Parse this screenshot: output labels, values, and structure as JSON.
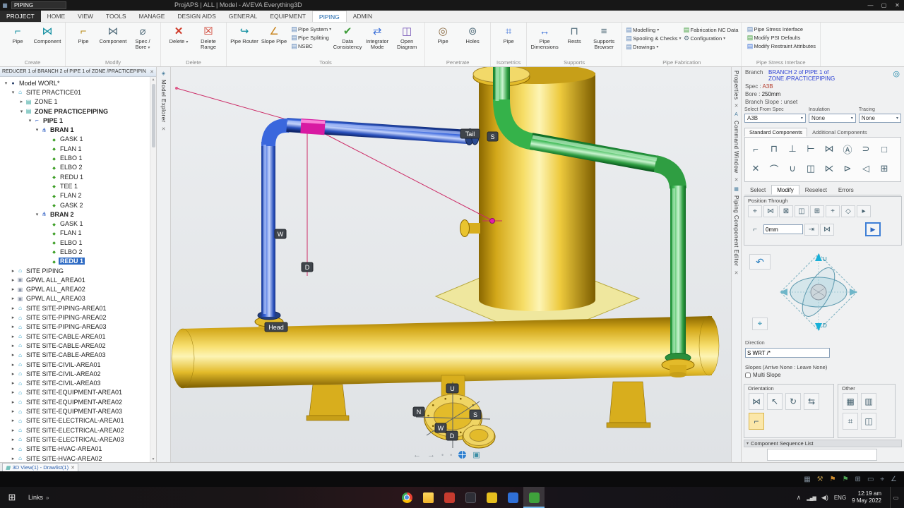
{
  "colors": {
    "selection": "#2e6bc4",
    "pipe_blue": "#2d5bd1",
    "pipe_green": "#35b24a",
    "equipment_yellow": "#e9c42f",
    "highlight_magenta": "#e31eaa",
    "construction_pink": "#cc2b66",
    "link_blue": "#2a3fd4",
    "spec_red": "#b23a2a"
  },
  "titlebar": {
    "quick_search": "PIPING",
    "title": "ProjAPS | ALL | Model - AVEVA Everything3D"
  },
  "tabs": [
    {
      "label": "PROJECT",
      "cls": "project"
    },
    {
      "label": "HOME"
    },
    {
      "label": "VIEW"
    },
    {
      "label": "TOOLS"
    },
    {
      "label": "MANAGE"
    },
    {
      "label": "DESIGN AIDS"
    },
    {
      "label": "GENERAL"
    },
    {
      "label": "EQUIPMENT"
    },
    {
      "label": "PIPING",
      "cls": "on"
    },
    {
      "label": "ADMIN"
    }
  ],
  "ribbon": {
    "groups": {
      "create": {
        "label": "Create",
        "pipe": "Pipe",
        "component": "Component"
      },
      "modify": {
        "label": "Modify",
        "pipe": "Pipe",
        "component": "Component",
        "spec_bore": "Spec / Bore"
      },
      "delete": {
        "label": "Delete",
        "del": "Delete",
        "range": "Delete Range"
      },
      "tools": {
        "label": "Tools",
        "router": "Pipe Router",
        "slope": "Slope Pipe",
        "checks": [
          {
            "label": "Pipe System",
            "icon": "rb-doc",
            "cls": "caret"
          },
          {
            "label": "Pipe Splitting",
            "icon": "rb-doc"
          },
          {
            "label": "NSBC",
            "icon": "rb-doc"
          }
        ],
        "data_consistency": "Data Consistency",
        "integrator": "Integrator Mode",
        "diagram": "Open Diagram"
      },
      "penetrate": {
        "label": "Penetrate",
        "pipe": "Pipe",
        "holes": "Holes"
      },
      "isometrics": {
        "label": "Isometrics",
        "pipe": "Pipe"
      },
      "supports": {
        "label": "Supports",
        "dimensions": "Pipe Dimensions",
        "rests": "Rests",
        "browser": "Supports Browser"
      },
      "fabrication": {
        "label": "Pipe Fabrication",
        "items": [
          {
            "label": "Modelling",
            "icon": "rb-doc",
            "cls": "caret"
          },
          {
            "label": "Spooling & Checks",
            "icon": "rb-doc",
            "cls": "caret"
          },
          {
            "label": "Drawings",
            "icon": "rb-doc",
            "cls": "caret"
          },
          {
            "label": "Fabrication NC Data",
            "icon": "rb-doc-g"
          },
          {
            "label": "Configuration",
            "icon": "rb-gear",
            "cls": "caret"
          }
        ]
      },
      "stress": {
        "label": "Pipe Stress Interface",
        "items": [
          {
            "label": "Pipe Stress Interface",
            "icon": "rb-doc"
          },
          {
            "label": "Modify PSI Defaults",
            "icon": "rb-doc-g"
          },
          {
            "label": "Modify Restraint Attributes",
            "icon": "rb-doc-b"
          }
        ]
      }
    }
  },
  "explorer": {
    "header": "REDUCER 1 of BRANCH 2 of PIPE 1 of ZONE /PRACTICEPIPIN",
    "strip_title": "Model Explorer",
    "items": [
      {
        "label": "Model WORL*",
        "cls": "d0 eo",
        "icon": "world"
      },
      {
        "label": "SITE PRACTICE01",
        "cls": "d1 eo",
        "icon": "site"
      },
      {
        "label": "ZONE 1",
        "cls": "d2 ec",
        "icon": "zone"
      },
      {
        "label": "ZONE PRACTICEPIPING",
        "cls": "d2 eo bold",
        "icon": "zone"
      },
      {
        "label": "PIPE 1",
        "cls": "d3 eo bold",
        "icon": "pipe"
      },
      {
        "label": "BRAN 1",
        "cls": "d4 eo bold",
        "icon": "bran"
      },
      {
        "label": "GASK 1",
        "cls": "d5 en",
        "icon": "comp"
      },
      {
        "label": "FLAN 1",
        "cls": "d5 en",
        "icon": "comp"
      },
      {
        "label": "ELBO 1",
        "cls": "d5 en",
        "icon": "comp"
      },
      {
        "label": "ELBO 2",
        "cls": "d5 en",
        "icon": "comp"
      },
      {
        "label": "REDU 1",
        "cls": "d5 en",
        "icon": "comp"
      },
      {
        "label": "TEE 1",
        "cls": "d5 en",
        "icon": "comp"
      },
      {
        "label": "FLAN 2",
        "cls": "d5 en",
        "icon": "comp"
      },
      {
        "label": "GASK 2",
        "cls": "d5 en",
        "icon": "comp"
      },
      {
        "label": "BRAN 2",
        "cls": "d4 eo bold",
        "icon": "bran"
      },
      {
        "label": "GASK 1",
        "cls": "d5 en",
        "icon": "comp"
      },
      {
        "label": "FLAN 1",
        "cls": "d5 en",
        "icon": "comp"
      },
      {
        "label": "ELBO 1",
        "cls": "d5 en",
        "icon": "comp"
      },
      {
        "label": "ELBO 2",
        "cls": "d5 en",
        "icon": "comp"
      },
      {
        "label": "REDU 1",
        "cls": "d5 en sel bold",
        "icon": "comp"
      },
      {
        "label": "SITE PIPING",
        "cls": "d1 ec",
        "icon": "site"
      },
      {
        "label": "GPWL ALL_AREA01",
        "cls": "d1 ec",
        "icon": "gpwl"
      },
      {
        "label": "GPWL ALL_AREA02",
        "cls": "d1 ec",
        "icon": "gpwl"
      },
      {
        "label": "GPWL ALL_AREA03",
        "cls": "d1 ec",
        "icon": "gpwl"
      },
      {
        "label": "SITE SITE-PIPING-AREA01",
        "cls": "d1 ec",
        "icon": "site"
      },
      {
        "label": "SITE SITE-PIPING-AREA02",
        "cls": "d1 ec",
        "icon": "site"
      },
      {
        "label": "SITE SITE-PIPING-AREA03",
        "cls": "d1 ec",
        "icon": "site"
      },
      {
        "label": "SITE SITE-CABLE-AREA01",
        "cls": "d1 ec",
        "icon": "site"
      },
      {
        "label": "SITE SITE-CABLE-AREA02",
        "cls": "d1 ec",
        "icon": "site"
      },
      {
        "label": "SITE SITE-CABLE-AREA03",
        "cls": "d1 ec",
        "icon": "site"
      },
      {
        "label": "SITE SITE-CIVIL-AREA01",
        "cls": "d1 ec",
        "icon": "site"
      },
      {
        "label": "SITE SITE-CIVIL-AREA02",
        "cls": "d1 ec",
        "icon": "site"
      },
      {
        "label": "SITE SITE-CIVIL-AREA03",
        "cls": "d1 ec",
        "icon": "site"
      },
      {
        "label": "SITE SITE-EQUIPMENT-AREA01",
        "cls": "d1 ec",
        "icon": "site"
      },
      {
        "label": "SITE SITE-EQUIPMENT-AREA02",
        "cls": "d1 ec",
        "icon": "site"
      },
      {
        "label": "SITE SITE-EQUIPMENT-AREA03",
        "cls": "d1 ec",
        "icon": "site"
      },
      {
        "label": "SITE SITE-ELECTRICAL-AREA01",
        "cls": "d1 ec",
        "icon": "site"
      },
      {
        "label": "SITE SITE-ELECTRICAL-AREA02",
        "cls": "d1 ec",
        "icon": "site"
      },
      {
        "label": "SITE SITE-ELECTRICAL-AREA03",
        "cls": "d1 ec",
        "icon": "site"
      },
      {
        "label": "SITE SITE-HVAC-AREA01",
        "cls": "d1 ec",
        "icon": "site"
      },
      {
        "label": "SITE SITE-HVAC-AREA02",
        "cls": "d1 ec",
        "icon": "site"
      }
    ]
  },
  "viewport": {
    "labels": {
      "tail": "Tail",
      "node_s": "S",
      "w": "W",
      "d": "D",
      "head": "Head",
      "c_u": "U",
      "c_n": "N",
      "c_s": "S",
      "c_w": "W",
      "c_d": "D"
    }
  },
  "right_strip": {
    "properties": "Properties",
    "command": "Command Window",
    "editor": "Piping Component Editor"
  },
  "editor": {
    "branch_label": "Branch",
    "branch_line1": "BRANCH 2 of PIPE 1 of",
    "branch_line2": "ZONE /PRACTICEPIPING",
    "spec_label": "Spec :",
    "spec_value": "A3B",
    "bore_label": "Bore :",
    "bore_value": "250mm",
    "slope_line": "Branch Slope : unset",
    "select_from_spec": {
      "label": "Select From Spec",
      "value": "A3B"
    },
    "insulation": {
      "label": "Insulation",
      "value": "None"
    },
    "tracing": {
      "label": "Tracing",
      "value": "None"
    },
    "component_tabs": [
      {
        "label": "Standard Components",
        "cls": "on"
      },
      {
        "label": "Additional Components"
      }
    ],
    "component_icons": [
      {
        "icon": "elbow-icon",
        "glyph": "⌐"
      },
      {
        "icon": "flanged-elbow-icon",
        "glyph": "⊓"
      },
      {
        "icon": "tee-icon",
        "glyph": "⊥"
      },
      {
        "icon": "olet-icon",
        "glyph": "⊢"
      },
      {
        "icon": "valve-icon",
        "glyph": "⋈"
      },
      {
        "icon": "instrument-icon",
        "glyph": "Ⓐ"
      },
      {
        "icon": "cap-icon",
        "glyph": "⊃"
      },
      {
        "icon": "block-icon",
        "glyph": "□"
      },
      {
        "icon": "cross-icon",
        "glyph": "✕"
      },
      {
        "icon": "bend-icon",
        "glyph": "⌒"
      },
      {
        "icon": "union-icon",
        "glyph": "∪"
      },
      {
        "icon": "coupling-icon",
        "glyph": "◫"
      },
      {
        "icon": "check-valve-icon",
        "glyph": "⋉"
      },
      {
        "icon": "three-way-valve-icon",
        "glyph": "⊳"
      },
      {
        "icon": "reducer-icon",
        "glyph": "◁"
      },
      {
        "icon": "attachment-icon",
        "glyph": "⊞"
      }
    ],
    "mode_tabs": [
      {
        "label": "Select"
      },
      {
        "label": "Modify",
        "cls": "on"
      },
      {
        "label": "Reselect"
      },
      {
        "label": "Errors"
      }
    ],
    "position_through": {
      "label": "Position Through",
      "distance": "0mm"
    },
    "position_icons": [
      {
        "icon": "distance-position-icon",
        "glyph": "⌖"
      },
      {
        "icon": "component-position-icon",
        "glyph": "⋈"
      },
      {
        "icon": "explicit-position-icon",
        "glyph": "⊠"
      },
      {
        "icon": "graphical-position-icon",
        "glyph": "◫"
      },
      {
        "icon": "element-position-icon",
        "glyph": "⊞"
      },
      {
        "icon": "id-point-icon",
        "glyph": "+"
      },
      {
        "icon": "extend-icon",
        "glyph": "◇"
      },
      {
        "icon": "pointer-icon",
        "glyph": "▸"
      }
    ],
    "position_icons2": [
      {
        "icon": "through-icon",
        "glyph": "⇥"
      },
      {
        "icon": "connect-icon",
        "glyph": "⋈"
      }
    ],
    "direction": {
      "label": "Direction",
      "value": "S WRT /*"
    },
    "slopes": "Slopes (Arrive None : Leave None)",
    "multi_slope": "Multi Slope",
    "orientation_label": "Orientation",
    "orientation_icons": [
      {
        "icon": "component-orientation-icon",
        "glyph": "⋈"
      },
      {
        "icon": "cursor-icon",
        "glyph": "↖"
      },
      {
        "icon": "rotate-icon",
        "glyph": "↻"
      },
      {
        "icon": "flip-icon",
        "glyph": "⇆"
      },
      {
        "icon": "axis-datum-icon",
        "glyph": "⌐",
        "cls": "hl"
      }
    ],
    "other_label": "Other",
    "other_icons": [
      {
        "icon": "frame-icon",
        "glyph": "▦"
      },
      {
        "icon": "plane-icon",
        "glyph": "▥"
      },
      {
        "icon": "move-icon",
        "glyph": "⌗"
      },
      {
        "icon": "align-icon",
        "glyph": "◫"
      }
    ],
    "sequence_label": "Component Sequence List",
    "gimbal": {
      "up": "U",
      "down": "D"
    }
  },
  "doc_tab": "3D View(1) - Drawlist(1)",
  "status_icons": [
    {
      "icon": "st-model"
    },
    {
      "icon": "st-hammer"
    },
    {
      "icon": "st-flag-a"
    },
    {
      "icon": "st-flag-b"
    },
    {
      "icon": "st-grid"
    },
    {
      "icon": "st-ruler"
    },
    {
      "icon": "st-target"
    },
    {
      "icon": "st-angle"
    }
  ],
  "taskbar": {
    "links": "Links",
    "apps": [
      {
        "icon": "chrome"
      },
      {
        "icon": "folder"
      },
      {
        "icon": "red-app"
      },
      {
        "icon": "dark-app"
      },
      {
        "icon": "yellow-app"
      },
      {
        "icon": "blue-app"
      },
      {
        "icon": "e3d",
        "cls": "on"
      }
    ],
    "lang": "ENG",
    "time": "12:19 am",
    "date": "9 May 2022"
  }
}
